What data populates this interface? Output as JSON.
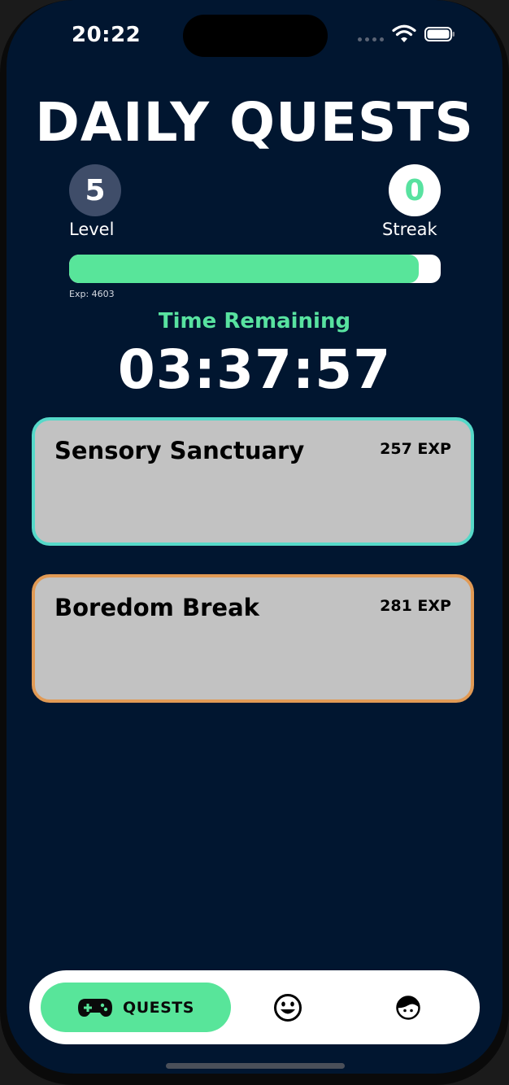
{
  "status_bar": {
    "time": "20:22"
  },
  "header": {
    "title": "DAILY QUESTS"
  },
  "stats": {
    "level_value": "5",
    "level_label": "Level",
    "streak_value": "0",
    "streak_label": "Streak",
    "exp_text": "Exp: 4603",
    "exp_progress": 0.94
  },
  "timer": {
    "label": "Time Remaining",
    "value": "03:37:57"
  },
  "quests": [
    {
      "name": "Sensory Sanctuary",
      "exp": "257 EXP",
      "border_color": "#56d9c9"
    },
    {
      "name": "Boredom Break",
      "exp": "281 EXP",
      "border_color": "#e19a55"
    }
  ],
  "tabbar": {
    "quests_label": "QUESTS",
    "quests_icon": "gamepad-icon",
    "mood_icon": "smiley-face-icon",
    "profile_icon": "profile-face-icon"
  },
  "colors": {
    "background": "#011630",
    "accent_green": "#58e59a",
    "card_gray": "#c2c2c2"
  }
}
